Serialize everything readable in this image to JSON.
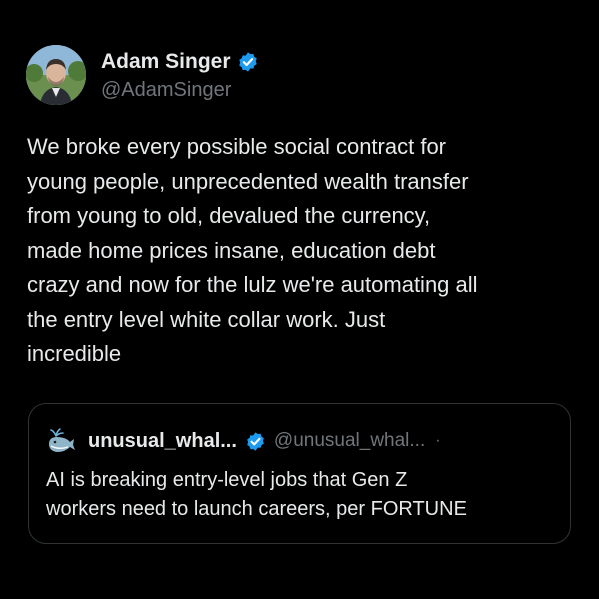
{
  "author": {
    "display_name": "Adam Singer",
    "handle": "@AdamSinger",
    "verified_icon": "verified-badge-icon",
    "avatar_icon": "profile-photo"
  },
  "tweet": {
    "lines": [
      "We broke every possible social contract for",
      "young people, unprecedented wealth transfer",
      "from young to old, devalued the currency,",
      "made home prices insane, education debt",
      "crazy and now for the lulz we're automating all",
      "the entry level white collar work. Just",
      "incredible"
    ]
  },
  "quoted_tweet": {
    "display_name": "unusual_whal...",
    "handle": "@unusual_whal...",
    "separator": "·",
    "avatar_icon": "whale-icon",
    "verified_icon": "verified-badge-icon",
    "lines": [
      "AI is breaking entry-level jobs that Gen Z",
      "workers need to launch careers, per FORTUNE"
    ]
  },
  "colors": {
    "background": "#000000",
    "text_primary": "#e7e9ea",
    "text_secondary": "#71767b",
    "verified_blue": "#1d9bf0",
    "border": "#2f3336"
  }
}
